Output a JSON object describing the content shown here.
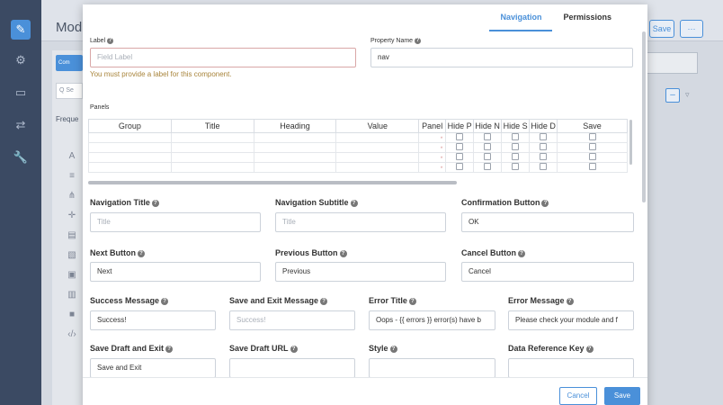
{
  "background": {
    "title": "Modu",
    "left_panel": {
      "tab": "Com",
      "search": "Q Se",
      "frequent": "Freque"
    },
    "header_buttons": {
      "save": "Save",
      "more": "···"
    }
  },
  "tabs": [
    "Navigation",
    "Permissions"
  ],
  "label_field": {
    "label": "Label",
    "placeholder": "Field Label",
    "error": "You must provide a label for this component."
  },
  "property_name": {
    "label": "Property Name",
    "value": "nav"
  },
  "panels": {
    "label": "Panels",
    "columns": [
      "Group",
      "Title",
      "Heading",
      "Value",
      "Panel",
      "Hide P",
      "Hide N",
      "Hide S",
      "Hide D",
      "Save"
    ]
  },
  "fields": {
    "nav_title": {
      "label": "Navigation Title",
      "placeholder": "Title"
    },
    "nav_subtitle": {
      "label": "Navigation Subtitle",
      "placeholder": "Title"
    },
    "confirm_button": {
      "label": "Confirmation Button",
      "value": "OK"
    },
    "next_button": {
      "label": "Next Button",
      "value": "Next"
    },
    "previous_button": {
      "label": "Previous Button",
      "value": "Previous"
    },
    "cancel_button": {
      "label": "Cancel Button",
      "value": "Cancel"
    },
    "success_message": {
      "label": "Success Message",
      "value": "Success!"
    },
    "save_exit_message": {
      "label": "Save and Exit Message",
      "placeholder": "Success!"
    },
    "error_title": {
      "label": "Error Title",
      "value": "Oops - {{ errors }} error(s) have b"
    },
    "error_message": {
      "label": "Error Message",
      "value": "Please check your module and f"
    },
    "save_draft_exit": {
      "label": "Save Draft and Exit",
      "value": "Save and Exit"
    },
    "save_draft_url": {
      "label": "Save Draft URL",
      "value": ""
    },
    "style": {
      "label": "Style",
      "value": ""
    },
    "data_reference_key": {
      "label": "Data Reference Key",
      "value": ""
    }
  },
  "footer": {
    "cancel": "Cancel",
    "save": "Save"
  },
  "colors": {
    "accent": "#4a90d9",
    "sidebar": "#3b4a63",
    "error_text": "#a8843b"
  }
}
